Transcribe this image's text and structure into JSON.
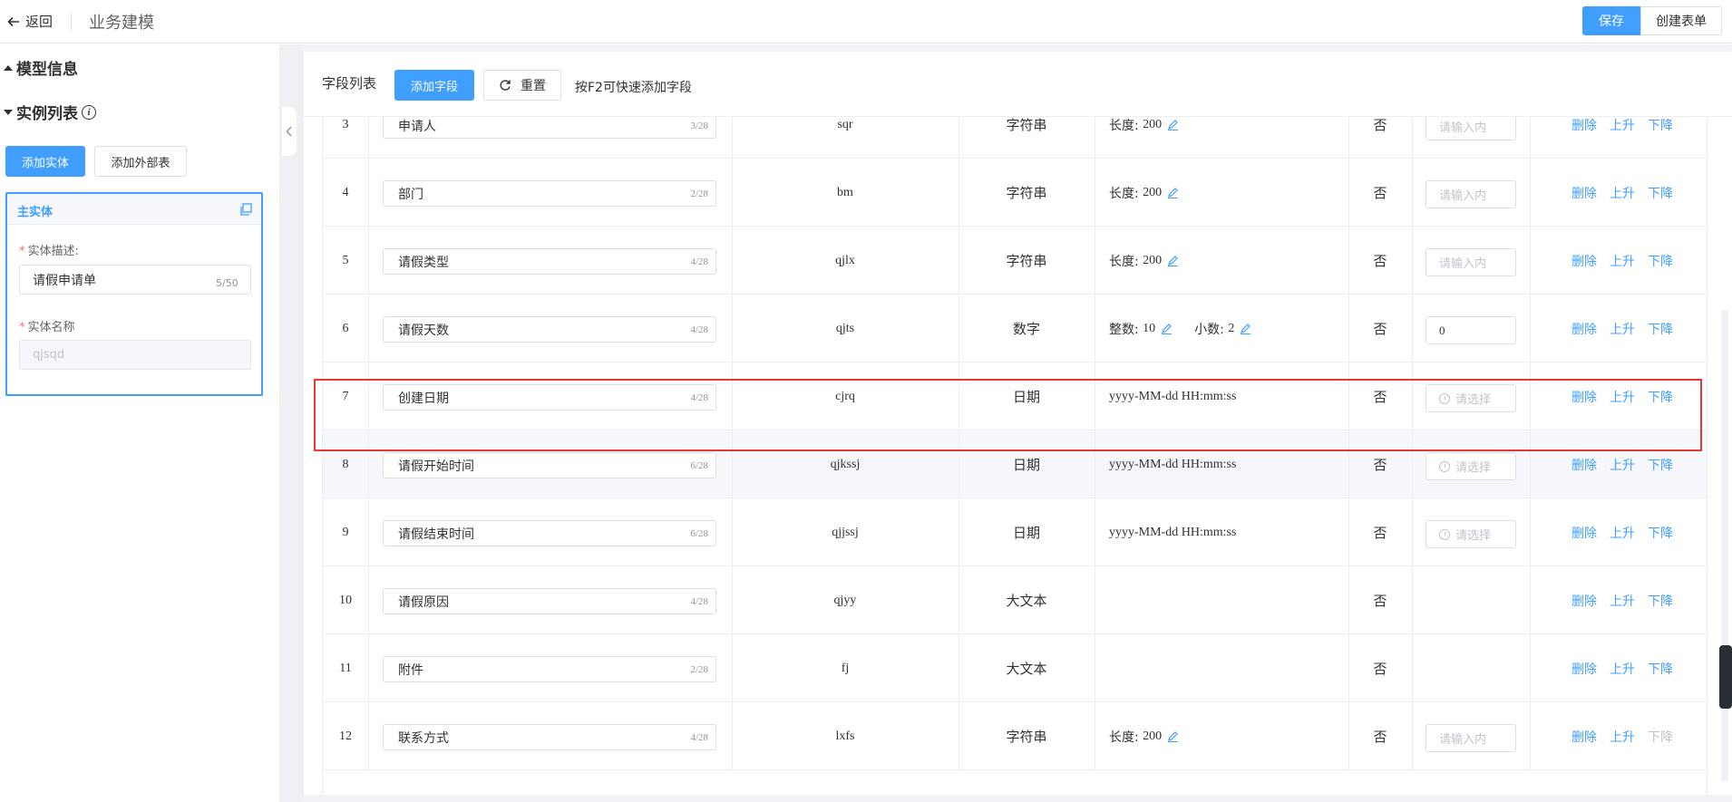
{
  "header": {
    "back_label": "返回",
    "page_title": "业务建模",
    "save_label": "保存",
    "create_form_label": "创建表单"
  },
  "sidebar": {
    "model_info_label": "模型信息",
    "instance_list_label": "实例列表",
    "add_entity_label": "添加实体",
    "add_external_label": "添加外部表",
    "entity_card": {
      "title": "主实体",
      "desc_label": "实体描述:",
      "desc_value": "请假申请单",
      "desc_count": "5/50",
      "name_label": "实体名称",
      "name_value": "qjsqd"
    }
  },
  "fields": {
    "title": "字段列表",
    "add_field_label": "添加字段",
    "reset_label": "重置",
    "hint": "按F2可快速添加字段",
    "attr_length_label": "长度:",
    "attr_int_label": "整数:",
    "attr_dec_label": "小数:",
    "op_delete": "删除",
    "op_up": "上升",
    "op_down": "下降",
    "rows": [
      {
        "no": "3",
        "name": "申请人",
        "count": "3/28",
        "code": "sqr",
        "type": "字符串",
        "attr_kind": "length",
        "length": "200",
        "required": "否",
        "default_kind": "text",
        "default": "请输入内",
        "highlight": false,
        "down_disabled": false
      },
      {
        "no": "4",
        "name": "部门",
        "count": "2/28",
        "code": "bm",
        "type": "字符串",
        "attr_kind": "length",
        "length": "200",
        "required": "否",
        "default_kind": "text",
        "default": "请输入内",
        "highlight": false,
        "down_disabled": false
      },
      {
        "no": "5",
        "name": "请假类型",
        "count": "4/28",
        "code": "qjlx",
        "type": "字符串",
        "attr_kind": "length",
        "length": "200",
        "required": "否",
        "default_kind": "text",
        "default": "请输入内",
        "highlight": false,
        "down_disabled": false
      },
      {
        "no": "6",
        "name": "请假天数",
        "count": "4/28",
        "code": "qjts",
        "type": "数字",
        "attr_kind": "number",
        "int": "10",
        "dec": "2",
        "required": "否",
        "default_kind": "value",
        "default": "0",
        "highlight": false,
        "down_disabled": false
      },
      {
        "no": "7",
        "name": "创建日期",
        "count": "4/28",
        "code": "cjrq",
        "type": "日期",
        "attr_kind": "format",
        "format": "yyyy-MM-dd HH:mm:ss",
        "required": "否",
        "default_kind": "date",
        "default": "请选择",
        "highlight": false,
        "down_disabled": false
      },
      {
        "no": "8",
        "name": "请假开始时间",
        "count": "6/28",
        "code": "qjkssj",
        "type": "日期",
        "attr_kind": "format",
        "format": "yyyy-MM-dd HH:mm:ss",
        "required": "否",
        "default_kind": "date",
        "default": "请选择",
        "highlight": true,
        "down_disabled": false
      },
      {
        "no": "9",
        "name": "请假结束时间",
        "count": "6/28",
        "code": "qjjssj",
        "type": "日期",
        "attr_kind": "format",
        "format": "yyyy-MM-dd HH:mm:ss",
        "required": "否",
        "default_kind": "date",
        "default": "请选择",
        "highlight": false,
        "down_disabled": false
      },
      {
        "no": "10",
        "name": "请假原因",
        "count": "4/28",
        "code": "qjyy",
        "type": "大文本",
        "attr_kind": "none",
        "required": "否",
        "default_kind": "none",
        "highlight": false,
        "down_disabled": false
      },
      {
        "no": "11",
        "name": "附件",
        "count": "2/28",
        "code": "fj",
        "type": "大文本",
        "attr_kind": "none",
        "required": "否",
        "default_kind": "none",
        "highlight": false,
        "down_disabled": false
      },
      {
        "no": "12",
        "name": "联系方式",
        "count": "4/28",
        "code": "lxfs",
        "type": "字符串",
        "attr_kind": "length",
        "length": "200",
        "required": "否",
        "default_kind": "text",
        "default": "请输入内",
        "highlight": false,
        "down_disabled": true
      }
    ]
  },
  "colors": {
    "primary": "#409eff",
    "highlight_box": "#e53935",
    "disabled_text": "#c0c4cc"
  }
}
